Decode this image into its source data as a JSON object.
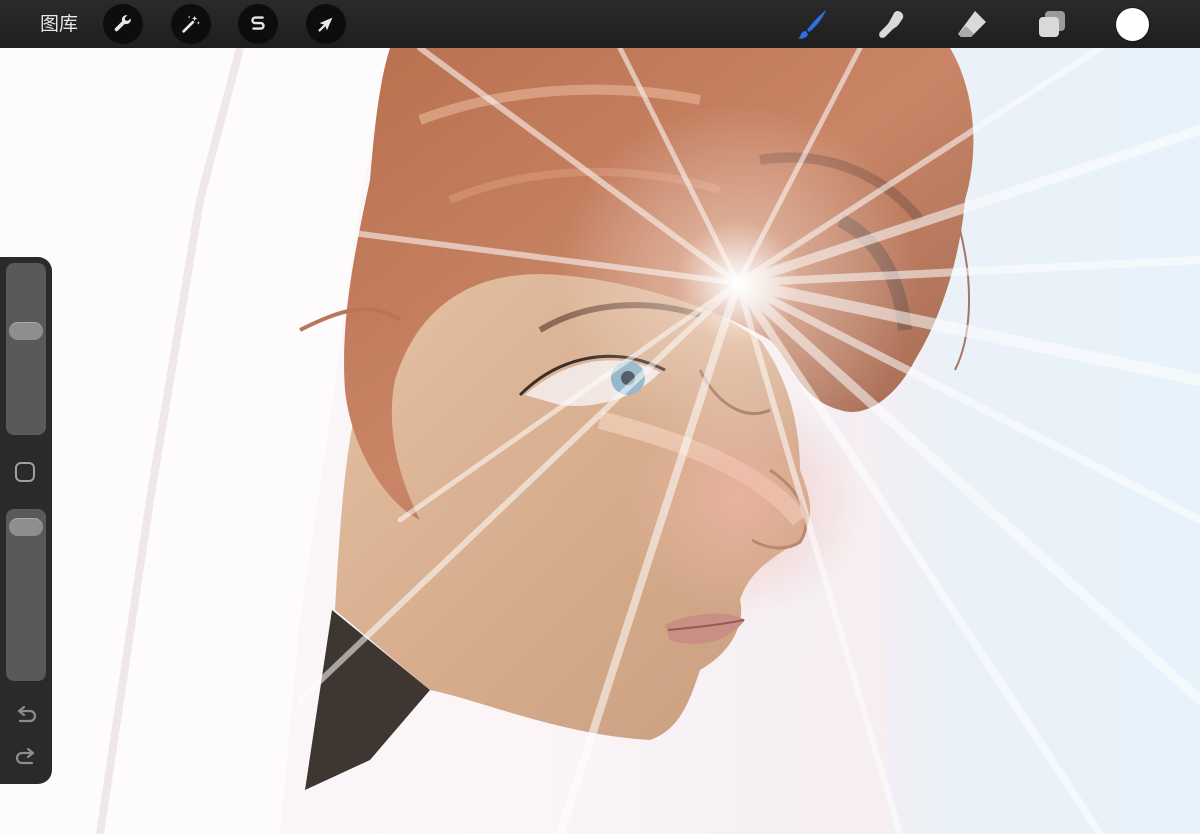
{
  "toolbar": {
    "gallery_label": "图库",
    "left_tools": [
      {
        "name": "actions",
        "icon": "wrench-icon"
      },
      {
        "name": "adjustments",
        "icon": "magic-wand-icon"
      },
      {
        "name": "selection",
        "icon": "selection-s-icon"
      },
      {
        "name": "transform",
        "icon": "arrow-cursor-icon"
      }
    ],
    "right_tools": [
      {
        "name": "brush",
        "icon": "brush-icon",
        "active": true
      },
      {
        "name": "smudge",
        "icon": "smudge-finger-icon",
        "active": false
      },
      {
        "name": "eraser",
        "icon": "eraser-icon",
        "active": false
      },
      {
        "name": "layers",
        "icon": "layers-icon",
        "active": false
      }
    ],
    "current_color": "#ffffff",
    "active_tool_color": "#2f6fe8"
  },
  "sidebar": {
    "brush_size_level": 0.38,
    "opacity_level": 0.04,
    "modify_icon": "square-modify-icon",
    "undo_icon": "undo-arrow-icon",
    "redo_icon": "redo-arrow-icon"
  }
}
